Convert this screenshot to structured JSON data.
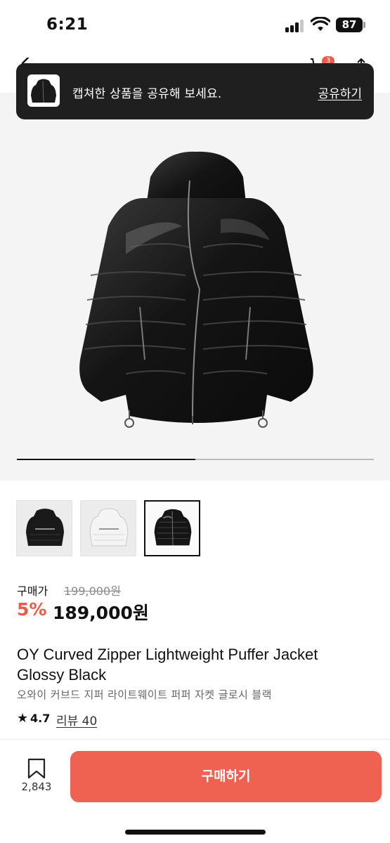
{
  "status_bar": {
    "time": "6:21",
    "battery_level": "87",
    "signal_bars_filled": 3,
    "signal_bars_total": 4
  },
  "nav": {
    "cart_badge_count": "3",
    "icons": [
      "back-arrow-icon",
      "cart-icon",
      "share-icon"
    ]
  },
  "toast": {
    "message": "캡쳐한 상품을 공유해 보세요.",
    "action_label": "공유하기"
  },
  "gallery": {
    "progress_fraction": 0.5,
    "thumbnails": [
      {
        "variant": "black-back-logo"
      },
      {
        "variant": "white-back-logo"
      },
      {
        "variant": "black-glossy",
        "selected": true
      }
    ]
  },
  "price": {
    "label": "구매가",
    "original": "199,000원",
    "discount": "5%",
    "final": "189,000원"
  },
  "product": {
    "title": "OY Curved Zipper Lightweight Puffer Jacket Glossy Black",
    "subtitle": "오와이 커브드 지퍼 라이트웨이트 퍼퍼 자켓 글로시 블랙",
    "rating_star": "★",
    "rating": "4.7",
    "reviews_label": "리뷰 40"
  },
  "bottom_bar": {
    "bookmark_count": "2,843",
    "buy_label": "구매하기"
  },
  "colors": {
    "accent": "#ef5b4b",
    "buy_button": "#ef6251",
    "toast_bg": "#1f1f1f"
  }
}
